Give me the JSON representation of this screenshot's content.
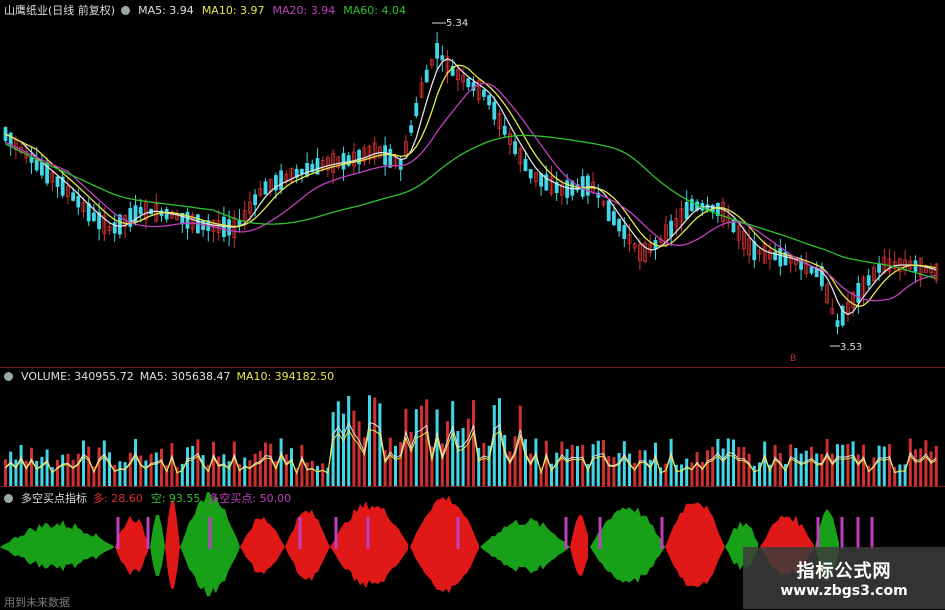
{
  "price_panel": {
    "title": "山鹰纸业(日线 前复权)",
    "ma_items": [
      {
        "label": "MA5: 3.94",
        "color": "#e0e0e0"
      },
      {
        "label": "MA10: 3.97",
        "color": "#e8e84a"
      },
      {
        "label": "MA20: 3.94",
        "color": "#c040c0"
      },
      {
        "label": "MA60: 4.04",
        "color": "#30c030"
      }
    ],
    "high_label": "5.34",
    "low_label": "3.53",
    "marker": "B"
  },
  "volume_panel": {
    "items": [
      {
        "label": "VOLUME: 340955.72",
        "color": "#e0e0e0"
      },
      {
        "label": "MA5: 305638.47",
        "color": "#e0e0e0"
      },
      {
        "label": "MA10: 394182.50",
        "color": "#e8e84a"
      }
    ]
  },
  "indicator_panel": {
    "name": "多空买点指标",
    "items": [
      {
        "label": "多: 28.60",
        "color": "#e03030"
      },
      {
        "label": "空: 93.55",
        "color": "#30c030"
      },
      {
        "label": "多空买点: 50.00",
        "color": "#c040c0"
      }
    ],
    "footer": "用到未来数据"
  },
  "watermark": {
    "title": "指标公式网",
    "url": "www.zbgs3.com"
  },
  "colors": {
    "up": "#d03030",
    "down": "#40d8e8",
    "ma5": "#e0e0e0",
    "ma10": "#e8e84a",
    "ma20": "#c040c0",
    "ma60": "#30c030"
  }
}
